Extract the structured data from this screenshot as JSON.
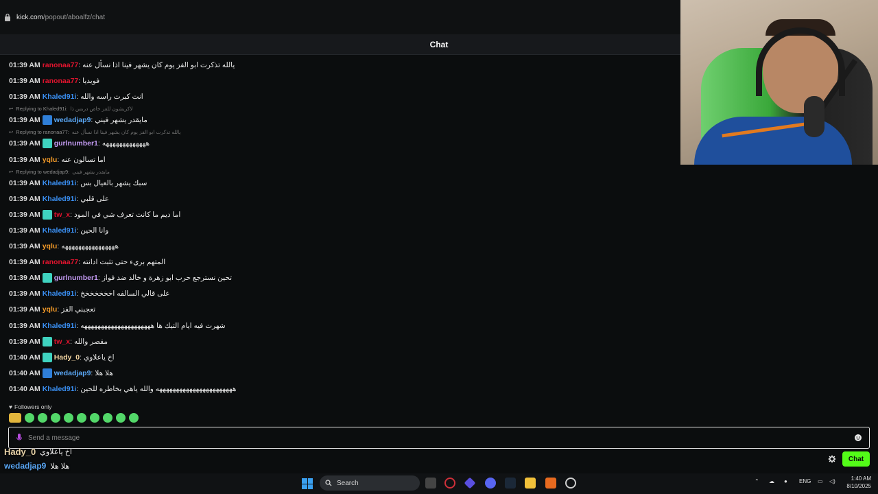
{
  "browser": {
    "url_host": "kick.com",
    "url_path": "/popout/aboalfz/chat"
  },
  "chat": {
    "title": "Chat",
    "followers_label": "Followers only",
    "input_placeholder": "Send a message",
    "send_label": "Chat",
    "messages": [
      {
        "time": "01:39 AM",
        "user": "ranonaa77",
        "color": "#e0142e",
        "badge": "",
        "text": "يالله تذكرت ابو الفز يوم كان يشهر فينا اذا نسأل عنه"
      },
      {
        "time": "01:39 AM",
        "user": "ranonaa77",
        "color": "#e0142e",
        "badge": "",
        "text": "فويديا"
      },
      {
        "time": "01:39 AM",
        "user": "Khaled91i",
        "color": "#3a8ff2",
        "badge": "",
        "text": "انت كبرت راسه والله"
      },
      {
        "time": "01:39 AM",
        "user": "wedadjap9",
        "color": "#5aa7f5",
        "badge": "vip",
        "text": "مايقدر يشهر فيني",
        "reply_to": "Replying to Khaled91i:",
        "reply_text": "لاكريشون للفز خاص دربس ذا"
      },
      {
        "time": "01:39 AM",
        "user": "gurlnumber1",
        "color": "#c59cf5",
        "badge": "sub",
        "text": "هههههههههههههه",
        "reply_to": "Replying to ranonaa77:",
        "reply_text": "يالله تذكرت ابو الفز يوم كان يشهر فينا اذا نسأل عنه"
      },
      {
        "time": "01:39 AM",
        "user": "yqlu",
        "color": "#f59b28",
        "badge": "",
        "text": "اما تسالون عنه"
      },
      {
        "time": "01:39 AM",
        "user": "Khaled91i",
        "color": "#3a8ff2",
        "badge": "",
        "text": "سبك يشهر بالعيال بس",
        "reply_to": "Replying to wedadjap9:",
        "reply_text": "مايقدر يشهر فيني"
      },
      {
        "time": "01:39 AM",
        "user": "Khaled91i",
        "color": "#3a8ff2",
        "badge": "",
        "text": "على قلبي"
      },
      {
        "time": "01:39 AM",
        "user": "tw_x",
        "color": "#e0142e",
        "badge": "sub",
        "text": "اما ديم ما كانت تعرف شي في المود"
      },
      {
        "time": "01:39 AM",
        "user": "Khaled91i",
        "color": "#3a8ff2",
        "badge": "",
        "text": "وانا الحين"
      },
      {
        "time": "01:39 AM",
        "user": "yqlu",
        "color": "#f59b28",
        "badge": "",
        "text": "ههههههههههههههههه"
      },
      {
        "time": "01:39 AM",
        "user": "ranonaa77",
        "color": "#e0142e",
        "badge": "",
        "text": "المتهم بريء حتى تثبت ادانته"
      },
      {
        "time": "01:39 AM",
        "user": "gurlnumber1",
        "color": "#c59cf5",
        "badge": "sub",
        "text": "تحين نسترجع حرب ابو زهرة و خالد ضد فواز"
      },
      {
        "time": "01:39 AM",
        "user": "Khaled91i",
        "color": "#3a8ff2",
        "badge": "",
        "text": "على قالي السالفه اخخخخخخخ"
      },
      {
        "time": "01:39 AM",
        "user": "yqlu",
        "color": "#f59b28",
        "badge": "",
        "text": "تعجبني الفز"
      },
      {
        "time": "01:39 AM",
        "user": "Khaled91i",
        "color": "#3a8ff2",
        "badge": "",
        "text": "شهرت فيه ايام التيك ها هههههههههههههههههههههه"
      },
      {
        "time": "01:39 AM",
        "user": "tw_x",
        "color": "#e0142e",
        "badge": "sub",
        "text": "مقصر والله"
      },
      {
        "time": "01:40 AM",
        "user": "Hady_0",
        "color": "#f5d7a3",
        "badge": "sub",
        "text": "اخ ياعلاوي"
      },
      {
        "time": "01:40 AM",
        "user": "wedadjap9",
        "color": "#5aa7f5",
        "badge": "vip",
        "text": "هلا هلا"
      },
      {
        "time": "01:40 AM",
        "user": "Khaled91i",
        "color": "#3a8ff2",
        "badge": "",
        "text": "هههههههههههههههههههههههه والله ياهي بخاطره للحين"
      }
    ]
  },
  "overlay": {
    "rows": [
      {
        "user": "Hady_0",
        "color": "#e8d3a8",
        "text": "اخ ياعلاوي"
      },
      {
        "user": "wedadjap9",
        "color": "#5aa7f5",
        "text": "هلا هلا"
      },
      {
        "user": "Khaled91i",
        "color": "#3a8ff2",
        "text": "ههههههههههههههههههههههه والله ياهي بخاطره للحين"
      }
    ]
  },
  "taskbar": {
    "search_label": "Search",
    "lang": "ENG",
    "time": "1:40 AM",
    "date": "8/10/2025"
  }
}
